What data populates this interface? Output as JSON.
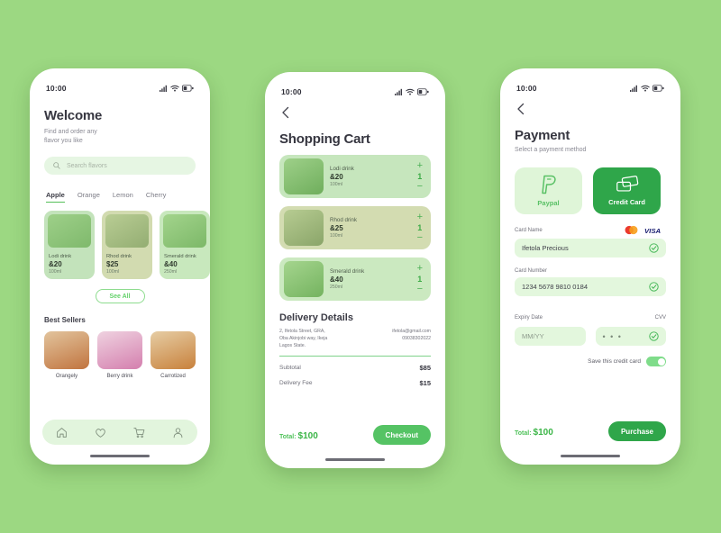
{
  "theme": {
    "background": "#9cd882",
    "accent_green": "#55c364",
    "dark_green": "#2fa64a",
    "light_green_field": "#e3f7dd"
  },
  "status_bar": {
    "time": "10:00",
    "icons": [
      "signal-icon",
      "wifi-icon",
      "battery-icon"
    ]
  },
  "screen_home": {
    "title": "Welcome",
    "subtitle": "Find and order any\nflavor you like",
    "search": {
      "placeholder": "Search flavors",
      "icon": "search-icon"
    },
    "tabs": [
      {
        "label": "Apple",
        "active": true
      },
      {
        "label": "Orange",
        "active": false
      },
      {
        "label": "Lemon",
        "active": false
      },
      {
        "label": "Cherry",
        "active": false
      }
    ],
    "products": [
      {
        "name": "Lodi drink",
        "price": "&20",
        "volume": "100ml",
        "card_bg": "#c3e3bb",
        "thumb_bg": "#b5dcab"
      },
      {
        "name": "Rhod drink",
        "price": "$25",
        "volume": "100ml",
        "card_bg": "#d2dbb0",
        "thumb_bg": "#c6d3a1"
      },
      {
        "name": "Smerald drink",
        "price": "&40",
        "volume": "250ml",
        "card_bg": "#c8e8bd",
        "thumb_bg": "#bbe0ae"
      }
    ],
    "see_all_label": "See All",
    "best_sellers_title": "Best Sellers",
    "best_sellers": [
      {
        "label": "Orangely",
        "img_bg": "#d9b48a"
      },
      {
        "label": "Berry drink",
        "img_bg": "#dda7c4"
      },
      {
        "label": "Carrotized",
        "img_bg": "#dcae83"
      }
    ],
    "nav_items": [
      "home-icon",
      "heart-icon",
      "cart-icon",
      "profile-icon"
    ]
  },
  "screen_cart": {
    "back_icon": "chevron-left-icon",
    "title": "Shopping Cart",
    "items": [
      {
        "name": "Lodi drink",
        "price": "&20",
        "volume": "100ml",
        "qty": "1",
        "plus": "+",
        "minus": "−",
        "bg": "#c6e6bd",
        "img_bg": "#b6dcab"
      },
      {
        "name": "Rhod drink",
        "price": "&25",
        "volume": "100ml",
        "qty": "1",
        "plus": "+",
        "minus": "−",
        "bg": "#d3dcb1",
        "img_bg": "#c7d4a2"
      },
      {
        "name": "Smerald drink",
        "price": "&40",
        "volume": "250ml",
        "qty": "1",
        "plus": "+",
        "minus": "−",
        "bg": "#cbe9c0",
        "img_bg": "#bde1b0"
      }
    ],
    "delivery_title": "Delivery Details",
    "address": "2, Ifetola Street, GRA,\nOba Akinjobi way, Ikeja\nLagos State.",
    "email": "ifetola@gmail.com",
    "phone": "09038302022",
    "summary": [
      {
        "label": "Subtotal",
        "value": "$85"
      },
      {
        "label": "Delivery Fee",
        "value": "$15"
      }
    ],
    "total_label": "Total:",
    "total_value": "$100",
    "checkout_label": "Checkout"
  },
  "screen_payment": {
    "back_icon": "chevron-left-icon",
    "title": "Payment",
    "subtitle": "Select a payment method",
    "methods": [
      {
        "label": "Paypal",
        "icon": "paypal-icon",
        "selected": false
      },
      {
        "label": "Credit Card",
        "icon": "credit-card-icon",
        "selected": true
      }
    ],
    "card_brands": [
      "mastercard-icon",
      "visa-icon"
    ],
    "fields": [
      {
        "label": "Card Name",
        "value": "Ifetola Precious",
        "is_placeholder": false,
        "check": "check-circle-icon"
      },
      {
        "label": "Card Number",
        "value": "1234 5678 9810 0184",
        "is_placeholder": false,
        "check": "check-circle-icon"
      }
    ],
    "expiry": {
      "label": "Expiry Date",
      "value": "MM/YY",
      "is_placeholder": true
    },
    "cvv": {
      "label": "CVV",
      "value": "• • •",
      "check": "check-circle-icon"
    },
    "save_card_label": "Save this credit card",
    "save_card_on": true,
    "total_label": "Total:",
    "total_value": "$100",
    "purchase_label": "Purchase"
  }
}
